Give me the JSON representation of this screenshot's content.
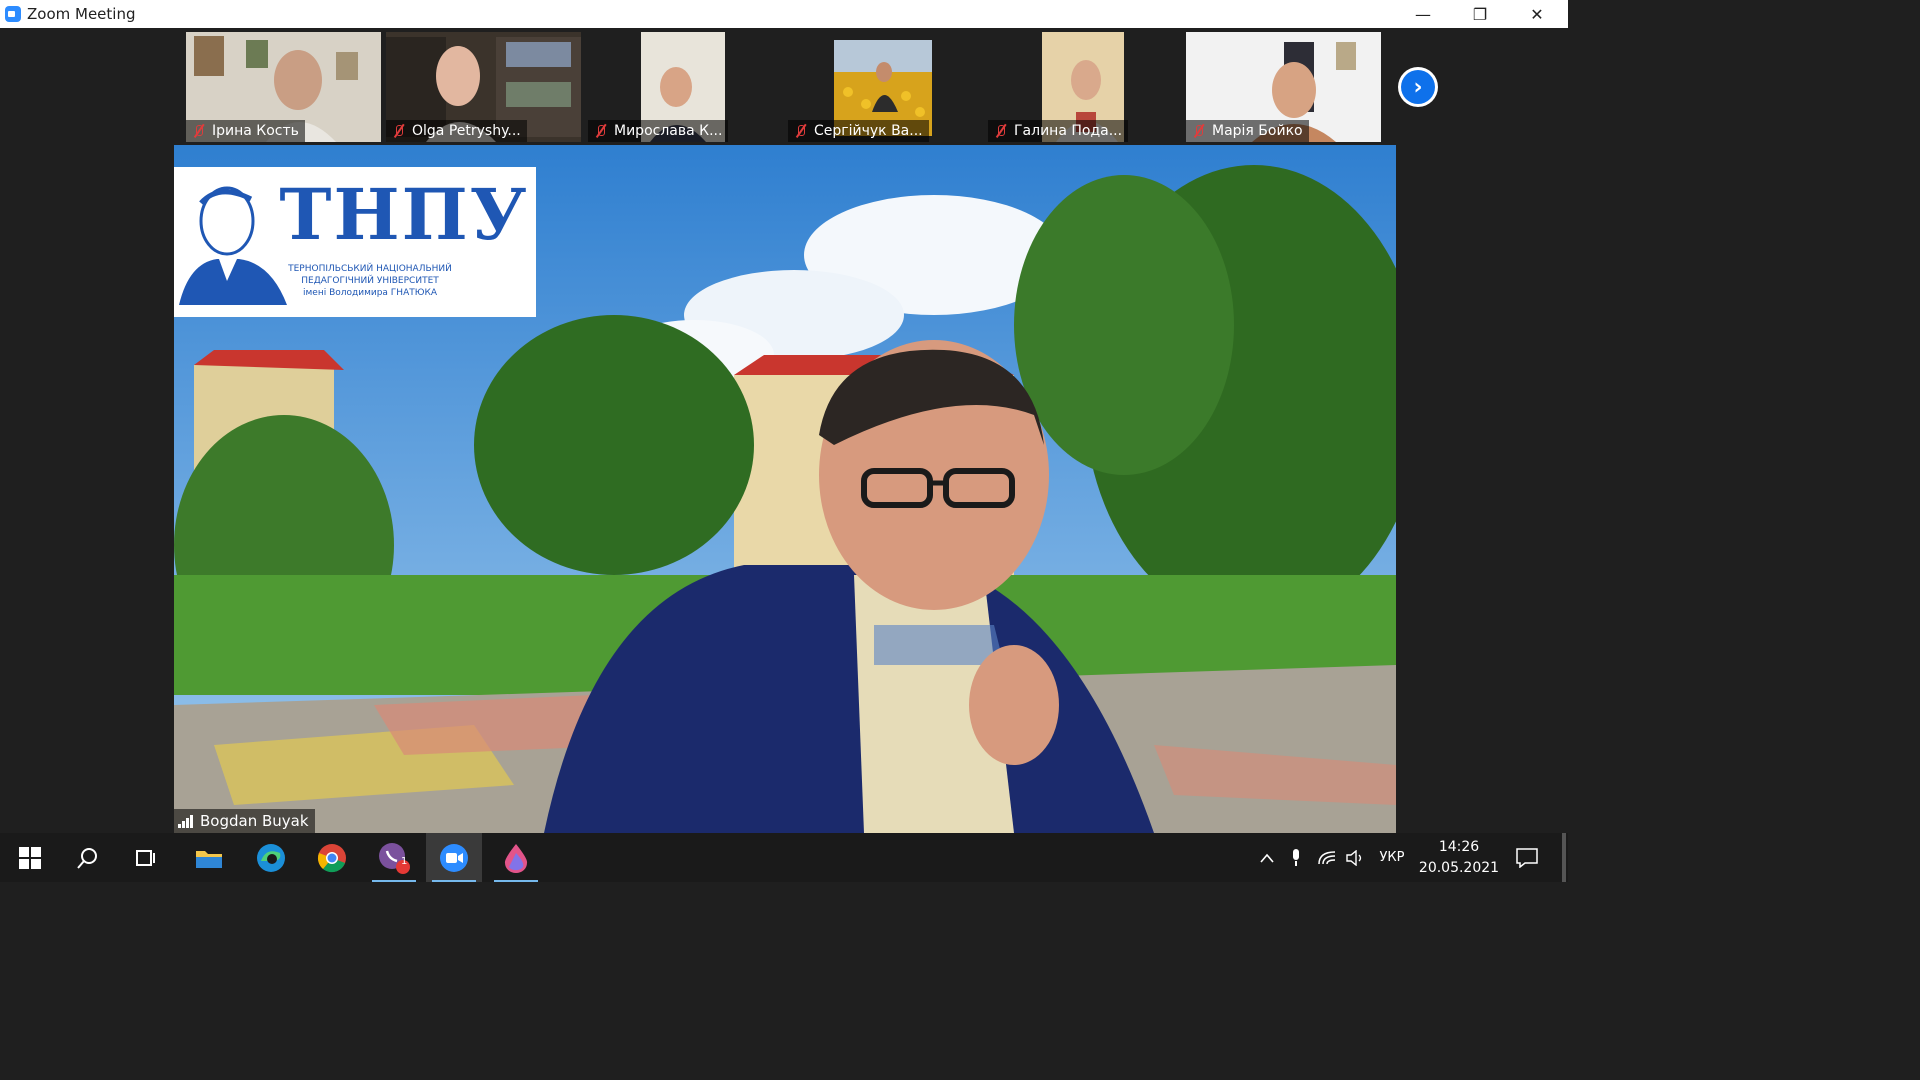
{
  "window": {
    "title": "Zoom Meeting",
    "minimize_glyph": "—",
    "restore_glyph": "❐",
    "close_glyph": "✕"
  },
  "gallery": {
    "participants": [
      {
        "name": "Ірина Кость",
        "muted": true
      },
      {
        "name": "Olga Petryshy...",
        "muted": true
      },
      {
        "name": "Мирослава К...",
        "muted": true
      },
      {
        "name": "Сергійчук Ва...",
        "muted": true
      },
      {
        "name": "Галина Пода...",
        "muted": true
      },
      {
        "name": "Марія Бойко",
        "muted": true
      }
    ],
    "next_page_glyph": "›"
  },
  "speaker": {
    "name": "Bogdan Buyak",
    "logo_text": "ТНПУ",
    "logo_subtitle_lines": [
      "ТЕРНОПІЛЬСЬКИЙ НАЦІОНАЛЬНИЙ",
      "ПЕДАГОГІЧНИЙ УНІВЕРСИТЕТ",
      "імені Володимира ГНАТЮКА"
    ]
  },
  "taskbar": {
    "apps": [
      {
        "icon": "windows-start-icon"
      },
      {
        "icon": "search-icon"
      },
      {
        "icon": "task-view-icon"
      },
      {
        "icon": "file-explorer-icon"
      },
      {
        "icon": "edge-icon"
      },
      {
        "icon": "chrome-icon"
      },
      {
        "icon": "viber-icon",
        "badge": "1"
      },
      {
        "icon": "zoom-icon",
        "active": true
      },
      {
        "icon": "color-drop-icon"
      }
    ],
    "language": "УКР",
    "time": "14:26",
    "date": "20.05.2021"
  },
  "colors": {
    "zoom_blue": "#2d8cff",
    "next_button_blue": "#0e71eb",
    "muted_red": "#e03c3c",
    "logo_blue": "#1f57b4"
  }
}
